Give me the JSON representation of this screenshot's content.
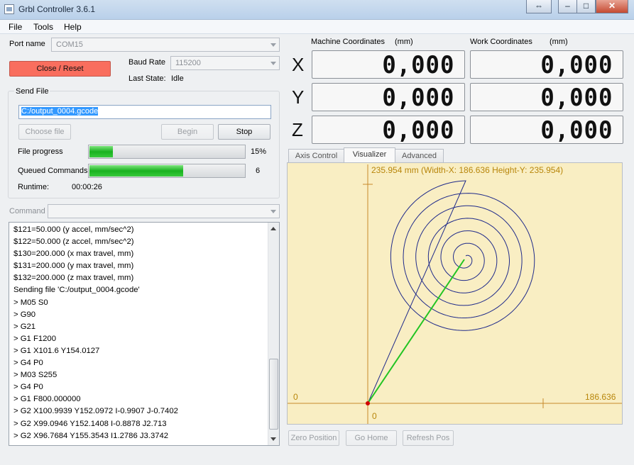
{
  "window": {
    "title": "Grbl Controller 3.6.1",
    "controls": {
      "restore": "⇔",
      "minimize": "–",
      "maximize": "□",
      "close": "✕"
    }
  },
  "menu": [
    "File",
    "Tools",
    "Help"
  ],
  "connection": {
    "port_label": "Port name",
    "port_value": "COM15",
    "close_button": "Close / Reset",
    "baud_label": "Baud Rate",
    "baud_value": "115200",
    "state_label": "Last State:",
    "state_value": "Idle"
  },
  "send_file": {
    "group_title": "Send File",
    "path": "C:/output_0004.gcode",
    "choose_button": "Choose file",
    "begin_button": "Begin",
    "stop_button": "Stop",
    "file_progress_label": "File progress",
    "file_progress_percent": 15,
    "file_progress_text": "15%",
    "queued_label": "Queued Commands",
    "queued_fraction": 0.6,
    "queued_count": "6",
    "runtime_label": "Runtime:",
    "runtime_value": "00:00:26"
  },
  "command": {
    "label": "Command",
    "value": ""
  },
  "console_lines": [
    "$121=50.000 (y accel, mm/sec^2)",
    "$122=50.000 (z accel, mm/sec^2)",
    "$130=200.000 (x max travel, mm)",
    "$131=200.000 (y max travel, mm)",
    "$132=200.000 (z max travel, mm)",
    "Sending file 'C:/output_0004.gcode'",
    "> M05 S0",
    "> G90",
    "> G21",
    "> G1 F1200",
    "> G1  X101.6 Y154.0127",
    "> G4 P0",
    "> M03 S255",
    "> G4 P0",
    "> G1 F800.000000",
    "> G2 X100.9939 Y152.0972 I-0.9907 J-0.7402",
    "> G2 X99.0946 Y152.1408 I-0.8878 J2.713",
    "> G2 X96.7684 Y155.3543 I1.2786 J3.3742"
  ],
  "coordinates": {
    "machine_label": "Machine Coordinates",
    "work_label": "Work Coordinates",
    "unit": "(mm)",
    "axes": [
      {
        "axis": "X",
        "machine": "0,000",
        "work": "0,000"
      },
      {
        "axis": "Y",
        "machine": "0,000",
        "work": "0,000"
      },
      {
        "axis": "Z",
        "machine": "0,000",
        "work": "0,000"
      }
    ]
  },
  "tabs": [
    "Axis Control",
    "Visualizer",
    "Advanced"
  ],
  "active_tab": "Visualizer",
  "visualizer": {
    "header": "235.954 mm  (Width-X: 186.636  Height-Y: 235.954)",
    "x_origin_label": "0",
    "y_origin_label": "0",
    "x_max_label": "186.636",
    "colors": {
      "background": "#f9eec3",
      "axes": "#c8892b",
      "path": "#1f2a8a",
      "current_move": "#22c422",
      "origin_dot": "#d00000",
      "label": "#b8860b"
    }
  },
  "bottom_buttons": [
    "Zero Position",
    "Go Home",
    "Refresh Pos"
  ]
}
